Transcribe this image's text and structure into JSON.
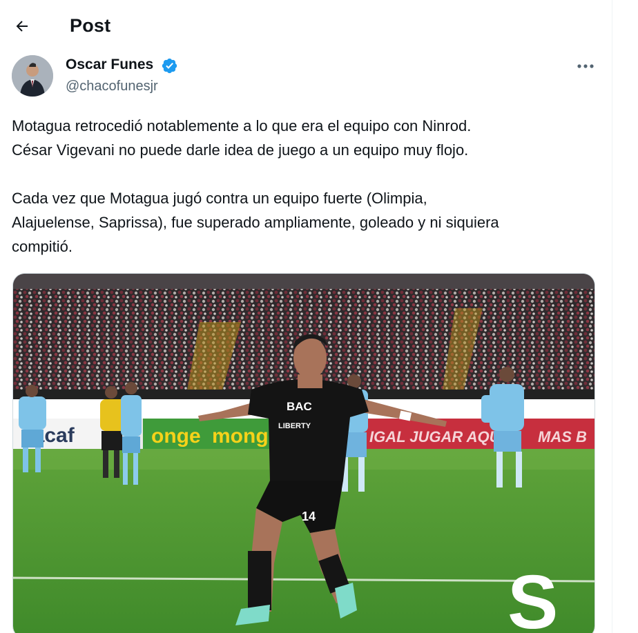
{
  "header": {
    "title": "Post"
  },
  "post": {
    "author": {
      "name": "Oscar Funes",
      "handle": "@chacofunesjr"
    },
    "text": [
      "Motagua retrocedió notablemente a lo que era el equipo con Ninrod.",
      "César Vigevani no puede darle idea de juego a un equipo muy flojo.",
      "",
      "Cada vez que Motagua jugó contra un equipo fuerte (Olimpia,",
      "Alajuelense, Saprissa), fue superado ampliamente, goleado y ni siquiera",
      "compitió."
    ],
    "media": {
      "ad_boards": [
        "cacaf",
        "onge",
        "monge",
        "IGAL JUGAR AQU",
        "MAS B"
      ],
      "jersey_sponsor": "BAC",
      "jersey_sponsor_2": "LIBERTY",
      "shorts_number": "14",
      "club_logo_letter": "S"
    }
  },
  "colors": {
    "accent": "#1d9bf0",
    "text": "#0f1419",
    "secondary": "#536471"
  },
  "icons": {
    "back": "arrow-left-icon",
    "verified": "verified-badge-icon",
    "more": "more-horizontal-icon"
  }
}
